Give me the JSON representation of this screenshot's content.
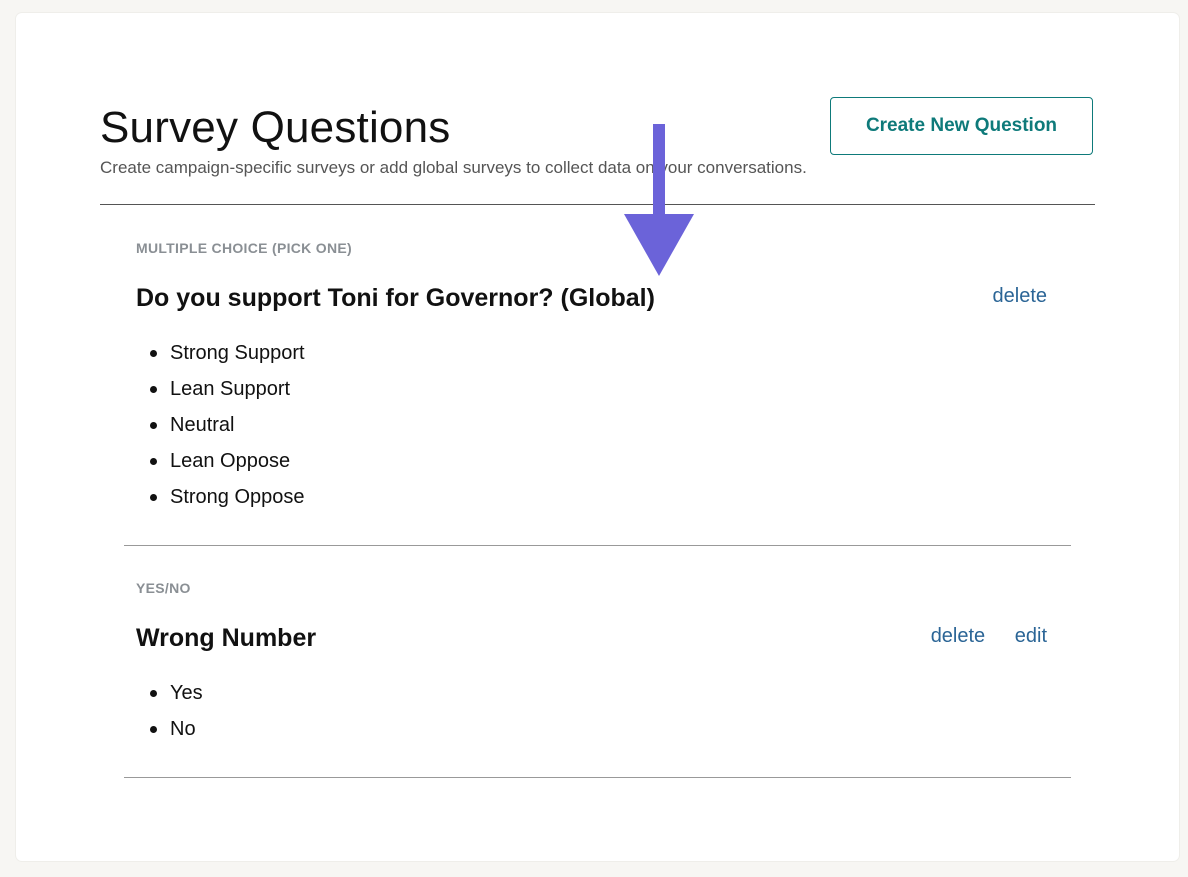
{
  "header": {
    "title": "Survey Questions",
    "subtitle": "Create campaign-specific surveys or add global surveys to collect data on your conversations.",
    "create_button": "Create New Question"
  },
  "questions": [
    {
      "type": "MULTIPLE CHOICE (PICK ONE)",
      "title": "Do you support Toni for Governor? (Global)",
      "actions": [
        "delete"
      ],
      "options": [
        "Strong Support",
        "Lean Support",
        "Neutral",
        "Lean Oppose",
        "Strong Oppose"
      ]
    },
    {
      "type": "YES/NO",
      "title": "Wrong Number",
      "actions": [
        "delete",
        "edit"
      ],
      "options": [
        "Yes",
        "No"
      ]
    }
  ],
  "colors": {
    "accent": "#0e7a7a",
    "link": "#2b6596",
    "arrow": "#6b63d9",
    "muted": "#8a8f94"
  },
  "icons": {
    "overlay": "down-arrow-icon"
  }
}
